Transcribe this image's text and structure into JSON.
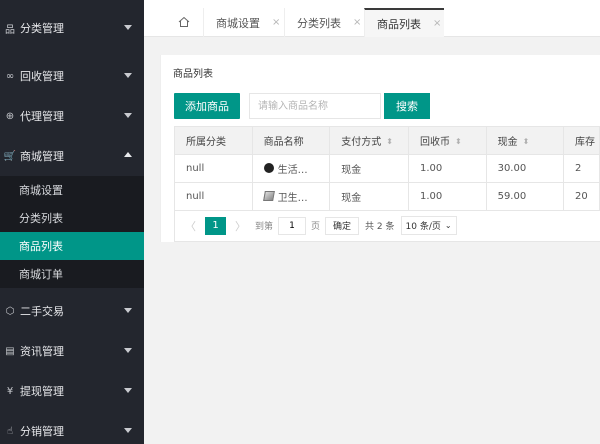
{
  "sidebar": {
    "items": [
      {
        "icon": "category-icon",
        "glyph": "品",
        "label": "分类管理"
      },
      {
        "icon": "recycle-icon",
        "glyph": "∞",
        "label": "回收管理"
      },
      {
        "icon": "agent-icon",
        "glyph": "⊕",
        "label": "代理管理"
      },
      {
        "icon": "cart-icon",
        "glyph": "🛒",
        "label": "商城管理"
      },
      {
        "icon": "cube-icon",
        "glyph": "⬡",
        "label": "二手交易"
      },
      {
        "icon": "news-icon",
        "glyph": "▤",
        "label": "资讯管理"
      },
      {
        "icon": "withdraw-icon",
        "glyph": "¥",
        "label": "提现管理"
      },
      {
        "icon": "distribution-icon",
        "glyph": "☝",
        "label": "分销管理"
      }
    ],
    "submenu": [
      {
        "label": "商城设置"
      },
      {
        "label": "分类列表"
      },
      {
        "label": "商品列表"
      },
      {
        "label": "商城订单"
      }
    ]
  },
  "tabs": [
    {
      "label": "商城设置",
      "close": "×"
    },
    {
      "label": "分类列表",
      "close": "×"
    },
    {
      "label": "商品列表",
      "close": "×"
    }
  ],
  "main": {
    "title": "商品列表",
    "add_button": "添加商品",
    "search_placeholder": "请输入商品名称",
    "search_button": "搜索",
    "columns": [
      "所属分类",
      "商品名称",
      "支付方式",
      "回收币",
      "现金",
      "库存"
    ],
    "sort_glyph": "⬍",
    "rows": [
      {
        "category": "null",
        "name": "生活…",
        "pay": "现金",
        "coin": "1.00",
        "cash": "30.00",
        "stock": "2"
      },
      {
        "category": "null",
        "name": "卫生…",
        "pay": "现金",
        "coin": "1.00",
        "cash": "59.00",
        "stock": "20"
      }
    ]
  },
  "pager": {
    "prev": "〈",
    "current": "1",
    "next": "〉",
    "goto_prefix": "到第",
    "goto_value": "1",
    "goto_suffix": "页",
    "confirm": "确定",
    "total": "共 2 条",
    "per_page": "10 条/页",
    "dropdown": "⌄"
  },
  "colors": {
    "accent": "#009688",
    "sidebar_bg": "#23262e",
    "submenu_bg": "#191b20"
  }
}
